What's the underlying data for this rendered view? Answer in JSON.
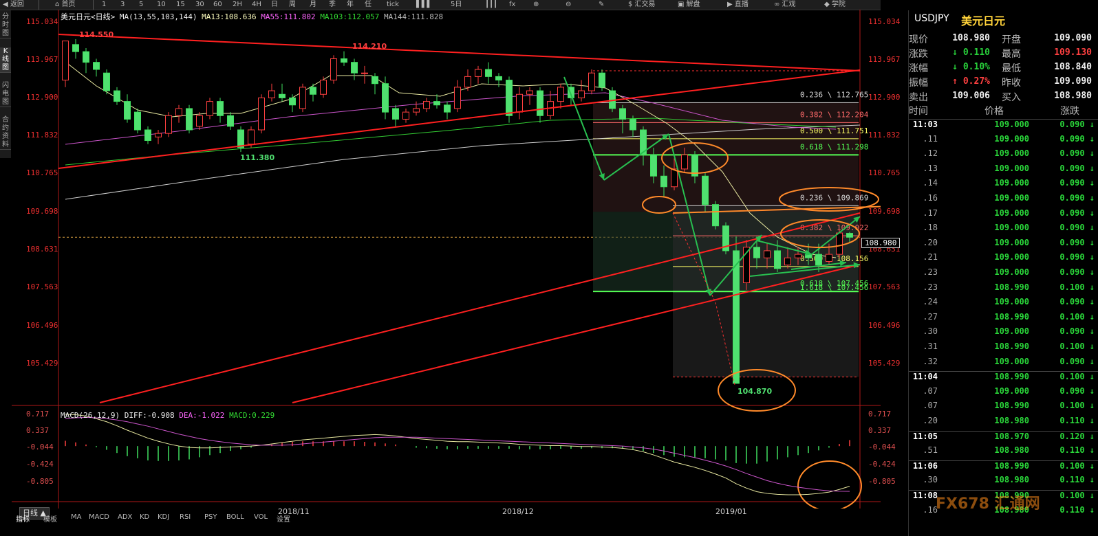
{
  "toolbar": {
    "back": "返回",
    "home": "首页",
    "periods": [
      "1",
      "3",
      "5",
      "10",
      "15",
      "30",
      "60",
      "2H",
      "4H",
      "日",
      "周",
      "月",
      "季",
      "年",
      "任",
      "tick"
    ],
    "five_day": "5日",
    "trade": "$ 汇交易",
    "unwind": "解盘",
    "live": "直播",
    "outlook": "汇观",
    "academy": "学院"
  },
  "side_tabs": [
    "分时图",
    "K线图",
    "闪电图",
    "合约资料"
  ],
  "chart_header": {
    "symbol": "美元日元",
    "period": "<日线>",
    "ma_label": "MA(13,55,103,144)",
    "ma13": "MA13:108.636",
    "ma55": "MA55:111.802",
    "ma103": "MA103:112.057",
    "ma144": "MA144:111.828"
  },
  "price_axis": [
    "115.034",
    "113.967",
    "112.900",
    "111.832",
    "110.765",
    "109.698",
    "108.631",
    "107.563",
    "106.496",
    "105.429"
  ],
  "current_price_tag": "108.980",
  "extremes": {
    "high_left": "114.550",
    "high_mid": "114.210",
    "low_left": "111.380",
    "low_right": "104.870"
  },
  "fib_levels": [
    {
      "label": "0.236 \\ 112.765",
      "color": "#d8d8d8"
    },
    {
      "label": "0.382 \\ 112.204",
      "color": "#ff6a6a"
    },
    {
      "label": "0.500 \\ 111.751",
      "color": "#ffff66"
    },
    {
      "label": "0.618 \\ 111.298",
      "color": "#55ff55"
    },
    {
      "label": "0.236 \\ 109.869",
      "color": "#d8d8d8"
    },
    {
      "label": "0.382 \\ 109.022",
      "color": "#ff6a6a"
    },
    {
      "label": "0.500 \\ 108.156",
      "color": "#ffff66"
    },
    {
      "label": "0.618 \\ 107.456",
      "color": "#55ff55"
    },
    {
      "label": "1.618 \\ 107.456",
      "color": "#55ff55"
    }
  ],
  "macd_header": {
    "label": "MACD(26,12,9)",
    "diff": "DIFF:-0.908",
    "dea": "DEA:-1.022",
    "macd": "MACD:0.229"
  },
  "macd_axis": [
    "0.717",
    "0.337",
    "-0.044",
    "-0.424",
    "-0.805"
  ],
  "x_axis": [
    "2018/11",
    "2018/12",
    "2019/01"
  ],
  "period_label": "日线 ▲",
  "bottom_tabs": [
    "指标",
    "模板",
    "MA",
    "MACD",
    "ADX",
    "KD",
    "KDJ",
    "RSI",
    "PSY",
    "BOLL",
    "VOL",
    "设置"
  ],
  "quote": {
    "symbol": "USDJPY",
    "name": "美元日元",
    "rows": [
      {
        "l1": "现价",
        "v1": "108.980",
        "c1": "wht",
        "l2": "开盘",
        "v2": "109.090",
        "c2": "wht"
      },
      {
        "l1": "涨跌",
        "v1": "↓ 0.110",
        "c1": "grn",
        "l2": "最高",
        "v2": "109.130",
        "c2": "red"
      },
      {
        "l1": "涨幅",
        "v1": "↓ 0.10%",
        "c1": "grn",
        "l2": "最低",
        "v2": "108.840",
        "c2": "wht"
      },
      {
        "l1": "振幅",
        "v1": "↑ 0.27%",
        "c1": "red",
        "l2": "昨收",
        "v2": "109.090",
        "c2": "wht"
      },
      {
        "l1": "卖出",
        "v1": "109.006",
        "c1": "wht",
        "l2": "买入",
        "v2": "108.980",
        "c2": "wht"
      }
    ],
    "tick_headers": [
      "时间",
      "价格",
      "涨跌"
    ],
    "ticks": [
      {
        "t": "11:03",
        "full": true,
        "p": "109.000",
        "c": "0.090 ↓"
      },
      {
        "t": ".11",
        "p": "109.000",
        "c": "0.090 ↓"
      },
      {
        "t": ".12",
        "p": "109.000",
        "c": "0.090 ↓"
      },
      {
        "t": ".13",
        "p": "109.000",
        "c": "0.090 ↓"
      },
      {
        "t": ".14",
        "p": "109.000",
        "c": "0.090 ↓"
      },
      {
        "t": ".16",
        "p": "109.000",
        "c": "0.090 ↓"
      },
      {
        "t": ".17",
        "p": "109.000",
        "c": "0.090 ↓"
      },
      {
        "t": ".18",
        "p": "109.000",
        "c": "0.090 ↓"
      },
      {
        "t": ".20",
        "p": "109.000",
        "c": "0.090 ↓"
      },
      {
        "t": ".21",
        "p": "109.000",
        "c": "0.090 ↓"
      },
      {
        "t": ".23",
        "p": "109.000",
        "c": "0.090 ↓"
      },
      {
        "t": ".23",
        "p": "108.990",
        "c": "0.100 ↓"
      },
      {
        "t": ".24",
        "p": "109.000",
        "c": "0.090 ↓"
      },
      {
        "t": ".27",
        "p": "108.990",
        "c": "0.100 ↓"
      },
      {
        "t": ".30",
        "p": "109.000",
        "c": "0.090 ↓"
      },
      {
        "t": ".31",
        "p": "108.990",
        "c": "0.100 ↓"
      },
      {
        "t": ".32",
        "p": "109.000",
        "c": "0.090 ↓"
      },
      {
        "t": "11:04",
        "full": true,
        "p": "108.990",
        "c": "0.100 ↓"
      },
      {
        "t": ".07",
        "p": "109.000",
        "c": "0.090 ↓"
      },
      {
        "t": ".07",
        "p": "108.990",
        "c": "0.100 ↓"
      },
      {
        "t": ".20",
        "p": "108.980",
        "c": "0.110 ↓"
      },
      {
        "t": "11:05",
        "full": true,
        "p": "108.970",
        "c": "0.120 ↓"
      },
      {
        "t": ".51",
        "p": "108.980",
        "c": "0.110 ↓"
      },
      {
        "t": "11:06",
        "full": true,
        "p": "108.990",
        "c": "0.100 ↓"
      },
      {
        "t": ".30",
        "p": "108.980",
        "c": "0.110 ↓"
      },
      {
        "t": "11:08",
        "full": true,
        "p": "108.990",
        "c": "0.100 ↓"
      },
      {
        "t": ".16",
        "p": "108.980",
        "c": "0.110 ↓"
      }
    ]
  },
  "watermark": "FX678 汇通网",
  "chart_data": {
    "type": "candlestick",
    "symbol": "USDJPY",
    "ylim": [
      104.5,
      115.3
    ],
    "candles": [
      [
        113.4,
        114.5,
        114.5,
        113.2
      ],
      [
        114.4,
        114.2,
        114.55,
        114.0
      ],
      [
        114.2,
        113.9,
        114.3,
        113.6
      ],
      [
        113.9,
        113.7,
        114.0,
        113.5
      ],
      [
        113.6,
        113.1,
        113.7,
        113.0
      ],
      [
        113.1,
        112.8,
        113.2,
        112.7
      ],
      [
        112.8,
        112.3,
        113.0,
        112.2
      ],
      [
        112.5,
        112.0,
        112.6,
        111.9
      ],
      [
        112.0,
        111.7,
        112.1,
        111.6
      ],
      [
        111.8,
        111.9,
        112.0,
        111.6
      ],
      [
        111.9,
        112.4,
        112.5,
        111.8
      ],
      [
        112.4,
        112.6,
        112.7,
        112.2
      ],
      [
        112.6,
        112.0,
        112.7,
        111.9
      ],
      [
        112.1,
        112.4,
        112.5,
        112.0
      ],
      [
        112.4,
        112.8,
        112.9,
        112.3
      ],
      [
        112.8,
        112.4,
        112.9,
        112.2
      ],
      [
        112.4,
        112.1,
        112.5,
        112.0
      ],
      [
        112.0,
        111.5,
        112.1,
        111.38
      ],
      [
        111.6,
        112.0,
        112.1,
        111.5
      ],
      [
        112.0,
        112.9,
        113.0,
        111.9
      ],
      [
        112.9,
        113.1,
        113.3,
        112.8
      ],
      [
        113.0,
        112.9,
        113.3,
        112.8
      ],
      [
        112.9,
        112.7,
        113.0,
        112.5
      ],
      [
        112.6,
        113.2,
        113.3,
        112.5
      ],
      [
        113.2,
        113.0,
        113.3,
        112.8
      ],
      [
        113.0,
        113.4,
        113.5,
        112.9
      ],
      [
        113.4,
        114.0,
        114.1,
        113.3
      ],
      [
        114.0,
        113.9,
        114.21,
        113.8
      ],
      [
        113.9,
        113.6,
        114.0,
        113.4
      ],
      [
        113.6,
        113.6,
        113.8,
        113.3
      ],
      [
        113.5,
        113.3,
        113.6,
        113.0
      ],
      [
        113.3,
        112.5,
        113.5,
        112.3
      ],
      [
        112.6,
        112.3,
        112.7,
        112.1
      ],
      [
        112.3,
        112.5,
        112.6,
        112.2
      ],
      [
        112.5,
        112.6,
        112.8,
        112.4
      ],
      [
        112.6,
        112.8,
        112.9,
        112.5
      ],
      [
        112.8,
        112.7,
        113.0,
        112.6
      ],
      [
        112.7,
        112.5,
        112.8,
        112.3
      ],
      [
        112.6,
        113.2,
        113.4,
        112.5
      ],
      [
        113.2,
        113.5,
        113.7,
        113.1
      ],
      [
        113.5,
        113.7,
        113.8,
        113.3
      ],
      [
        113.7,
        113.5,
        113.9,
        113.3
      ],
      [
        113.5,
        113.4,
        113.6,
        113.2
      ],
      [
        113.4,
        112.4,
        113.5,
        112.2
      ],
      [
        112.5,
        113.0,
        113.2,
        112.3
      ],
      [
        113.0,
        113.1,
        113.2,
        112.7
      ],
      [
        113.1,
        112.4,
        113.2,
        112.2
      ],
      [
        112.4,
        112.8,
        113.1,
        112.3
      ],
      [
        112.8,
        113.2,
        113.3,
        112.6
      ],
      [
        113.2,
        112.9,
        113.3,
        112.7
      ],
      [
        112.9,
        113.1,
        113.4,
        112.8
      ],
      [
        113.1,
        113.6,
        113.7,
        113.0
      ],
      [
        113.6,
        113.2,
        113.7,
        113.1
      ],
      [
        113.1,
        112.6,
        113.2,
        112.5
      ],
      [
        112.6,
        112.3,
        112.7,
        111.9
      ],
      [
        112.3,
        112.0,
        112.4,
        111.8
      ],
      [
        112.0,
        111.3,
        112.1,
        111.0
      ],
      [
        111.3,
        110.7,
        111.5,
        110.5
      ],
      [
        110.7,
        110.4,
        111.0,
        110.1
      ],
      [
        110.4,
        110.9,
        111.2,
        110.3
      ],
      [
        110.9,
        111.3,
        111.5,
        110.8
      ],
      [
        111.3,
        110.7,
        111.4,
        110.5
      ],
      [
        110.7,
        109.9,
        110.8,
        109.7
      ],
      [
        109.9,
        109.3,
        110.0,
        109.2
      ],
      [
        109.3,
        108.6,
        109.4,
        108.5
      ],
      [
        108.6,
        104.87,
        109.0,
        104.87
      ],
      [
        107.7,
        108.7,
        108.9,
        107.5
      ],
      [
        108.7,
        108.4,
        109.0,
        108.1
      ],
      [
        108.4,
        108.6,
        108.8,
        108.1
      ],
      [
        108.6,
        108.1,
        108.9,
        108.0
      ],
      [
        108.2,
        108.4,
        108.7,
        108.1
      ],
      [
        108.4,
        108.5,
        108.7,
        108.2
      ],
      [
        108.5,
        108.4,
        108.8,
        108.2
      ],
      [
        108.5,
        108.2,
        108.8,
        108.0
      ],
      [
        108.3,
        108.5,
        108.8,
        108.2
      ],
      [
        108.5,
        109.1,
        109.2,
        108.4
      ],
      [
        109.09,
        108.98,
        109.13,
        108.84
      ]
    ],
    "ma_lines": [
      "MA13",
      "MA55",
      "MA103",
      "MA144"
    ],
    "macd": {
      "diff": [
        0.72,
        0.71,
        0.68,
        0.62,
        0.55,
        0.46,
        0.36,
        0.27,
        0.18,
        0.11,
        0.05,
        0.0,
        -0.03,
        -0.04,
        -0.04,
        -0.03,
        -0.02,
        -0.01,
        0.0,
        0.02,
        0.05,
        0.08,
        0.11,
        0.14,
        0.16,
        0.18,
        0.2,
        0.22,
        0.24,
        0.25,
        0.26,
        0.25,
        0.23,
        0.2,
        0.17,
        0.15,
        0.13,
        0.11,
        0.1,
        0.1,
        0.09,
        0.08,
        0.07,
        0.06,
        0.04,
        0.03,
        0.02,
        0.01,
        0.01,
        0.0,
        -0.01,
        -0.01,
        -0.02,
        -0.03,
        -0.05,
        -0.08,
        -0.13,
        -0.2,
        -0.28,
        -0.36,
        -0.42,
        -0.48,
        -0.55,
        -0.63,
        -0.72,
        -0.85,
        -0.95,
        -1.03,
        -1.07,
        -1.09,
        -1.1,
        -1.1,
        -1.09,
        -1.07,
        -1.04,
        -0.98,
        -0.908
      ],
      "dea": [
        0.62,
        0.64,
        0.65,
        0.64,
        0.62,
        0.59,
        0.55,
        0.5,
        0.45,
        0.39,
        0.33,
        0.27,
        0.22,
        0.17,
        0.13,
        0.1,
        0.07,
        0.05,
        0.03,
        0.02,
        0.02,
        0.02,
        0.03,
        0.05,
        0.07,
        0.09,
        0.11,
        0.13,
        0.15,
        0.17,
        0.19,
        0.2,
        0.2,
        0.2,
        0.2,
        0.19,
        0.18,
        0.17,
        0.16,
        0.15,
        0.14,
        0.13,
        0.12,
        0.11,
        0.1,
        0.09,
        0.08,
        0.07,
        0.06,
        0.05,
        0.04,
        0.03,
        0.02,
        0.01,
        0.0,
        -0.02,
        -0.04,
        -0.07,
        -0.11,
        -0.16,
        -0.21,
        -0.26,
        -0.32,
        -0.38,
        -0.45,
        -0.53,
        -0.62,
        -0.7,
        -0.78,
        -0.84,
        -0.89,
        -0.93,
        -0.96,
        -0.99,
        -1.01,
        -1.02,
        -1.022
      ]
    }
  }
}
